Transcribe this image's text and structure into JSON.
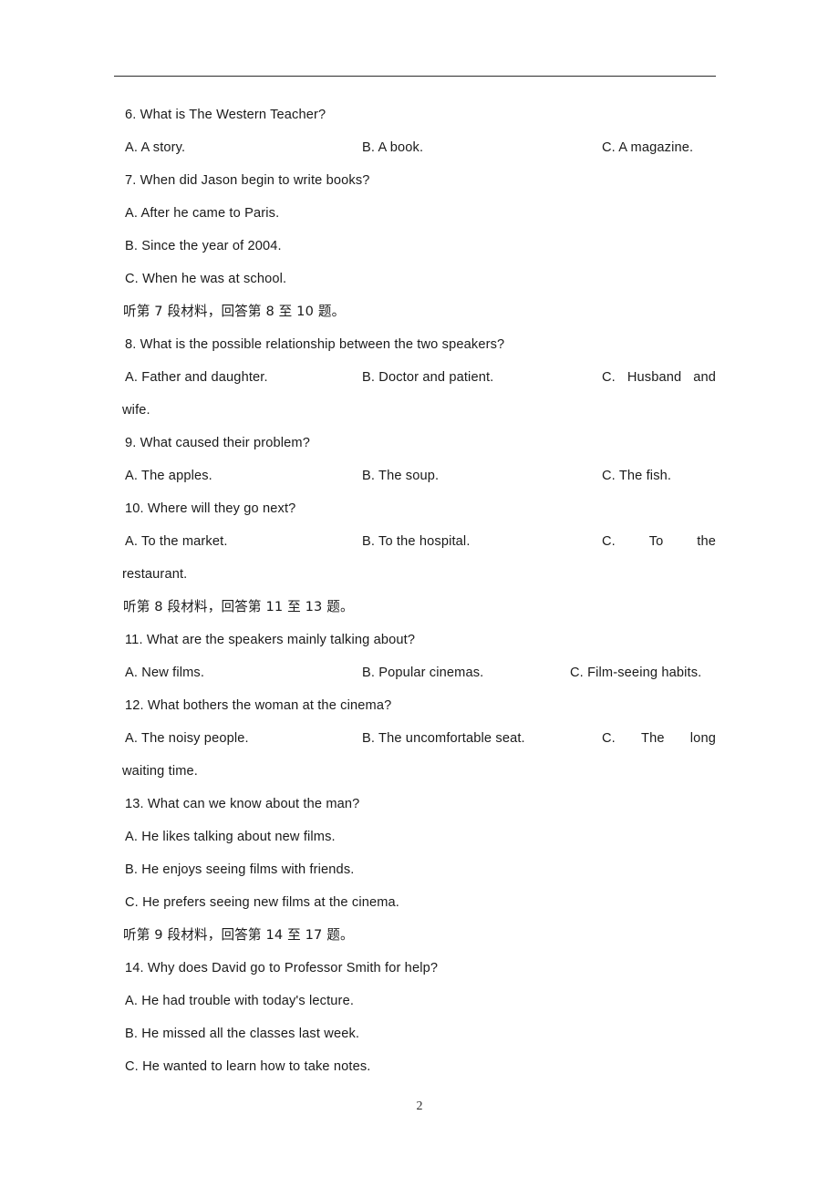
{
  "document": {
    "page_number": "2",
    "header_rule": true,
    "accent_color": "#1a1a1a"
  },
  "lines": [
    {
      "id": "q6",
      "type": "question",
      "a": "6. What is The Western Teacher?"
    },
    {
      "id": "q6-opts",
      "type": "options",
      "a": "A. A story.",
      "b": "B. A book.",
      "c": "C. A magazine."
    },
    {
      "id": "q7",
      "type": "question",
      "a": "7. When did Jason begin to write books?"
    },
    {
      "id": "q7-a",
      "type": "option",
      "a": "A. After he came to Paris."
    },
    {
      "id": "q7-b",
      "type": "option",
      "a": "B. Since the year of 2004."
    },
    {
      "id": "q7-c",
      "type": "option",
      "a": "C. When he was at school."
    },
    {
      "id": "cjk-7",
      "type": "cjk",
      "a": "听第 7 段材料，回答第 8 至 10 题。"
    },
    {
      "id": "q8",
      "type": "question",
      "a": "8. What is the possible relationship between the two speakers?"
    },
    {
      "id": "q8-opts",
      "type": "options-justified",
      "a": "A. Father and daughter.",
      "b": "B. Doctor and patient.",
      "c_parts": [
        "C.",
        "Husband",
        "and"
      ]
    },
    {
      "id": "q8-c-wrap",
      "type": "continuation",
      "a": "wife."
    },
    {
      "id": "q9",
      "type": "question",
      "a": "9. What caused their problem?"
    },
    {
      "id": "q9-opts",
      "type": "options",
      "a": "A. The apples.",
      "b": "B. The soup.",
      "c": "C. The fish."
    },
    {
      "id": "q10",
      "type": "question",
      "a": "10. Where will they go next?"
    },
    {
      "id": "q10-opts",
      "type": "options-justified",
      "a": "A. To the market.",
      "b": "B. To the hospital.",
      "c_parts": [
        "C.",
        "To",
        "the"
      ]
    },
    {
      "id": "q10-c-wrap",
      "type": "continuation",
      "a": "restaurant."
    },
    {
      "id": "cjk-8",
      "type": "cjk",
      "a": "听第 8 段材料，回答第 11 至 13 题。"
    },
    {
      "id": "q11",
      "type": "question",
      "a": "11. What are the speakers mainly talking about?"
    },
    {
      "id": "q11-opts",
      "type": "options-c-left",
      "a": "A. New films.",
      "b": "B. Popular cinemas.",
      "c": "C. Film-seeing habits."
    },
    {
      "id": "q12",
      "type": "question",
      "a": "12. What bothers the woman at the cinema?"
    },
    {
      "id": "q12-opts",
      "type": "options-justified",
      "a": "A. The noisy people.",
      "b": "B. The uncomfortable seat.",
      "c_parts": [
        "C.",
        "The",
        "long"
      ]
    },
    {
      "id": "q12-c-wrap",
      "type": "continuation",
      "a": "waiting time."
    },
    {
      "id": "q13",
      "type": "question",
      "a": "13. What can we know about the man?"
    },
    {
      "id": "q13-a",
      "type": "option",
      "a": "A. He likes talking about new films."
    },
    {
      "id": "q13-b",
      "type": "option",
      "a": "B. He enjoys seeing films with friends."
    },
    {
      "id": "q13-c",
      "type": "option",
      "a": "C. He prefers seeing new films at the cinema."
    },
    {
      "id": "cjk-9",
      "type": "cjk",
      "a": "听第 9 段材料，回答第 14 至 17 题。"
    },
    {
      "id": "q14",
      "type": "question",
      "a": "14. Why does David go to Professor Smith for help?"
    },
    {
      "id": "q14-a",
      "type": "option",
      "a": "A. He had trouble with today's lecture."
    },
    {
      "id": "q14-b",
      "type": "option",
      "a": "B. He missed all the classes last week."
    },
    {
      "id": "q14-c",
      "type": "option",
      "a": "C. He wanted to learn how to take notes."
    }
  ]
}
